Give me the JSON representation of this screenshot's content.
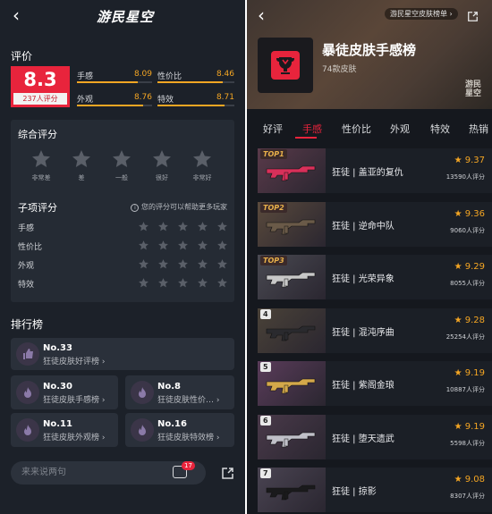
{
  "left": {
    "logo": "游民星空",
    "rating_title": "评价",
    "score": "8.3",
    "reviewers": "237人评分",
    "metrics": [
      {
        "label": "手感",
        "value": "8.09",
        "fill": 0.809
      },
      {
        "label": "性价比",
        "value": "8.46",
        "fill": 0.846
      },
      {
        "label": "外观",
        "value": "8.76",
        "fill": 0.876
      },
      {
        "label": "特效",
        "value": "8.71",
        "fill": 0.871
      }
    ],
    "overall_title": "综合评分",
    "star_labels": [
      "非常差",
      "差",
      "一般",
      "很好",
      "非常好"
    ],
    "sub_title": "子项评分",
    "sub_hint": "您的评分可以帮助更多玩家",
    "sub_items": [
      "手感",
      "性价比",
      "外观",
      "特效"
    ],
    "ranking_title": "排行榜",
    "rankings": [
      {
        "no": "No.33",
        "name": "狂徒皮肤好评榜"
      },
      {
        "no": "No.30",
        "name": "狂徒皮肤手感榜"
      },
      {
        "no": "No.8",
        "name": "狂徒皮肤性价…"
      },
      {
        "no": "No.11",
        "name": "狂徒皮肤外观榜"
      },
      {
        "no": "No.16",
        "name": "狂徒皮肤特效榜"
      }
    ],
    "comment_placeholder": "来来说两句",
    "comment_count": "17"
  },
  "right": {
    "pill": "游民星空皮肤榜单",
    "title": "暴徒皮肤手感榜",
    "subtitle": "74款皮肤",
    "watermark": "游民\n星空",
    "tabs": [
      "好评",
      "手感",
      "性价比",
      "外观",
      "特效",
      "热销"
    ],
    "active_tab": 1,
    "items": [
      {
        "rank": "TOP1",
        "name": "狂徒 | 盖亚的复仇",
        "score": "9.37",
        "count": "13590人评分",
        "color": "#d9305a",
        "thumb": "#5a3a4a"
      },
      {
        "rank": "TOP2",
        "name": "狂徒 | 逆命中队",
        "score": "9.36",
        "count": "9060人评分",
        "color": "#6a5a48",
        "thumb": "#5a4a3c"
      },
      {
        "rank": "TOP3",
        "name": "狂徒 | 光荣异象",
        "score": "9.29",
        "count": "8055人评分",
        "color": "#c8c8c8",
        "thumb": "#4a4a52"
      },
      {
        "rank": "4",
        "name": "狂徒 | 混沌序曲",
        "score": "9.28",
        "count": "25254人评分",
        "color": "#2a2a2e",
        "thumb": "#4a4238"
      },
      {
        "rank": "5",
        "name": "狂徒 | 紫阁金琅",
        "score": "9.19",
        "count": "10887人评分",
        "color": "#d4a84a",
        "thumb": "#5a3c5a"
      },
      {
        "rank": "6",
        "name": "狂徒 | 堕天遗武",
        "score": "9.19",
        "count": "5598人评分",
        "color": "#c0c0c8",
        "thumb": "#4a3a4a"
      },
      {
        "rank": "7",
        "name": "狂徒 | 掠影",
        "score": "9.08",
        "count": "8307人评分",
        "color": "#1a1a1c",
        "thumb": "#4a4452"
      }
    ]
  }
}
